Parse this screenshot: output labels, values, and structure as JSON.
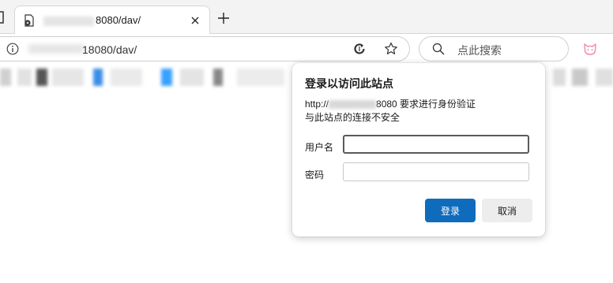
{
  "tab": {
    "title": "8080/dav/"
  },
  "address_bar": {
    "url": "18080/dav/"
  },
  "search": {
    "placeholder": "点此搜索"
  },
  "icons": {
    "tab_favicon": "globe-page-icon",
    "tab_close": "close-icon",
    "new_tab": "plus-icon",
    "site_info": "info-icon",
    "refresh": "refresh-icon",
    "favorite": "star-icon",
    "search": "search-icon",
    "profile": "cat-profile-icon"
  },
  "dialog": {
    "title": "登录以访问此站点",
    "message_prefix": "http://",
    "message_suffix": "8080 要求进行身份验证",
    "message_line2": "与此站点的连接不安全",
    "username_label": "用户名",
    "password_label": "密码",
    "username_value": "",
    "password_value": "",
    "login_button": "登录",
    "cancel_button": "取消"
  },
  "colors": {
    "primary_button": "#0f6cbd",
    "profile_icon": "#f48fb1"
  }
}
